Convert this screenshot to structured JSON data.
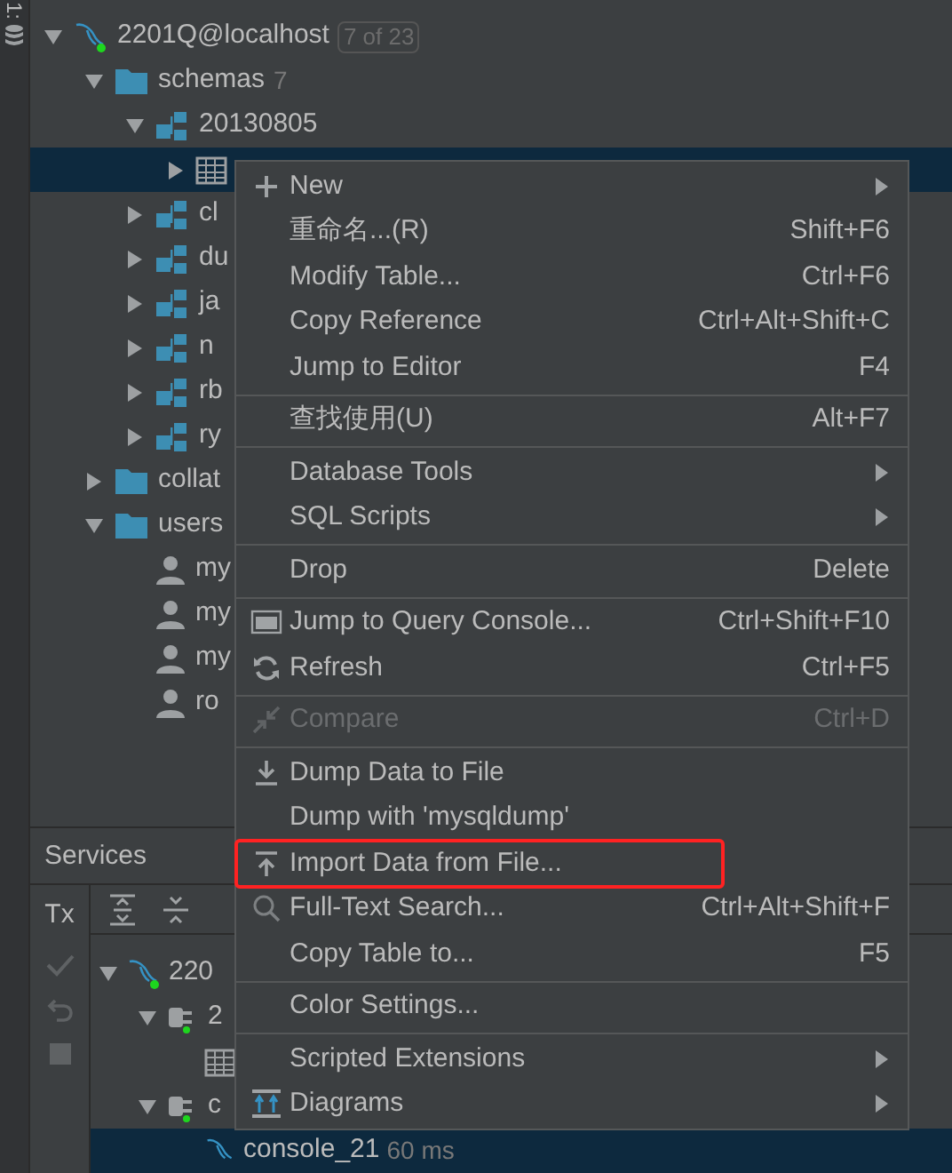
{
  "side_tab": {
    "label": "1:"
  },
  "tree": [
    {
      "kind": "connection",
      "label": "2201Q@localhost",
      "badge": "7 of 23",
      "expanded": true,
      "selected": false,
      "children": [
        {
          "kind": "folder",
          "label": "schemas",
          "count": "7",
          "expanded": true,
          "selected": false,
          "children": [
            {
              "kind": "schema",
              "label": "20130805",
              "expanded": true,
              "selected": false,
              "children": [
                {
                  "kind": "table",
                  "expanded": false,
                  "selected": true
                }
              ]
            },
            {
              "kind": "schema",
              "label": "cl",
              "expanded": false,
              "selected": false
            },
            {
              "kind": "schema",
              "label": "du",
              "expanded": false,
              "selected": false
            },
            {
              "kind": "schema",
              "label": "ja",
              "expanded": false,
              "selected": false
            },
            {
              "kind": "schema",
              "label": "n",
              "expanded": false,
              "selected": false
            },
            {
              "kind": "schema",
              "label": "rb",
              "expanded": false,
              "selected": false
            },
            {
              "kind": "schema",
              "label": "ry",
              "expanded": false,
              "selected": false
            }
          ]
        },
        {
          "kind": "folder",
          "label": "collat",
          "expanded": false,
          "selected": false
        },
        {
          "kind": "folder",
          "label": "users",
          "expanded": true,
          "selected": false,
          "children": [
            {
              "kind": "user",
              "label": "my",
              "selected": false
            },
            {
              "kind": "user",
              "label": "my",
              "selected": false
            },
            {
              "kind": "user",
              "label": "my",
              "selected": false
            },
            {
              "kind": "user",
              "label": "ro",
              "selected": false
            }
          ]
        }
      ]
    }
  ],
  "services": {
    "title": "Services",
    "tx": "Tx",
    "tree": [
      {
        "kind": "connection",
        "label": "220",
        "expanded": true,
        "selected": false,
        "children": [
          {
            "kind": "session",
            "label": "2",
            "expanded": true,
            "selected": false,
            "children": [
              {
                "kind": "table",
                "selected": false
              }
            ]
          },
          {
            "kind": "session",
            "label": "c",
            "expanded": true,
            "selected": false,
            "children": [
              {
                "kind": "console",
                "label": "console_21",
                "detail": "60 ms",
                "selected": true
              }
            ]
          }
        ]
      }
    ]
  },
  "context_menu": {
    "groups": [
      [
        {
          "label": "New",
          "submenu": true,
          "disabled": false,
          "highlighted": false
        },
        {
          "label": "重命名...(R)",
          "shortcut": "Shift+F6",
          "submenu": false,
          "disabled": false,
          "highlighted": false
        },
        {
          "label": "Modify Table...",
          "shortcut": "Ctrl+F6",
          "submenu": false,
          "disabled": false,
          "highlighted": false
        },
        {
          "label": "Copy Reference",
          "shortcut": "Ctrl+Alt+Shift+C",
          "submenu": false,
          "disabled": false,
          "highlighted": false
        },
        {
          "label": "Jump to Editor",
          "shortcut": "F4",
          "submenu": false,
          "disabled": false,
          "highlighted": false
        }
      ],
      [
        {
          "label": "查找使用(U)",
          "shortcut": "Alt+F7",
          "submenu": false,
          "disabled": false,
          "highlighted": false
        }
      ],
      [
        {
          "label": "Database Tools",
          "submenu": true,
          "disabled": false,
          "highlighted": false
        },
        {
          "label": "SQL Scripts",
          "submenu": true,
          "disabled": false,
          "highlighted": false
        }
      ],
      [
        {
          "label": "Drop",
          "shortcut": "Delete",
          "submenu": false,
          "disabled": false,
          "highlighted": false
        }
      ],
      [
        {
          "label": "Jump to Query Console...",
          "shortcut": "Ctrl+Shift+F10",
          "submenu": false,
          "disabled": false,
          "highlighted": false
        },
        {
          "label": "Refresh",
          "shortcut": "Ctrl+F5",
          "submenu": false,
          "disabled": false,
          "highlighted": false
        }
      ],
      [
        {
          "label": "Compare",
          "shortcut": "Ctrl+D",
          "submenu": false,
          "disabled": true,
          "highlighted": false
        }
      ],
      [
        {
          "label": "Dump Data to File",
          "submenu": false,
          "disabled": false,
          "highlighted": false
        },
        {
          "label": "Dump with 'mysqldump'",
          "submenu": false,
          "disabled": false,
          "highlighted": false
        },
        {
          "label": "Import Data from File...",
          "submenu": false,
          "disabled": false,
          "highlighted": true
        },
        {
          "label": "Full-Text Search...",
          "shortcut": "Ctrl+Alt+Shift+F",
          "submenu": false,
          "disabled": false,
          "highlighted": false
        },
        {
          "label": "Copy Table to...",
          "shortcut": "F5",
          "submenu": false,
          "disabled": false,
          "highlighted": false
        }
      ],
      [
        {
          "label": "Color Settings...",
          "submenu": false,
          "disabled": false,
          "highlighted": false
        }
      ],
      [
        {
          "label": "Scripted Extensions",
          "submenu": true,
          "disabled": false,
          "highlighted": false
        },
        {
          "label": "Diagrams",
          "submenu": true,
          "disabled": false,
          "highlighted": false
        }
      ]
    ]
  }
}
